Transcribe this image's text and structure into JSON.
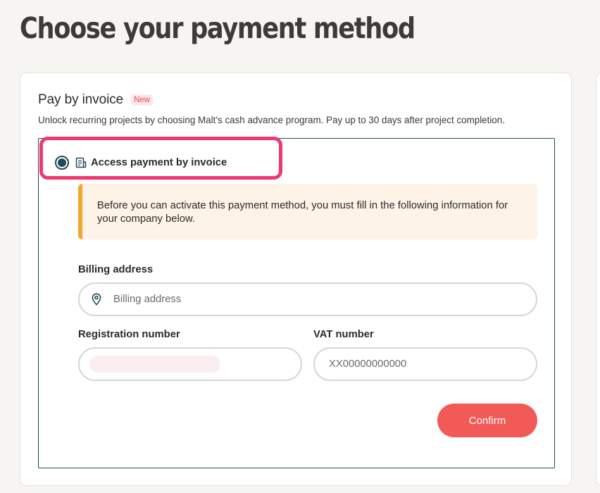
{
  "page": {
    "title": "Choose your payment method"
  },
  "invoice_section": {
    "title": "Pay by invoice",
    "badge": "New",
    "description": "Unlock recurring projects by choosing Malt’s cash advance program. Pay up to 30 days after project completion.",
    "option": {
      "label": "Access payment by invoice",
      "selected": true,
      "icon": "invoice-icon"
    },
    "notice": {
      "text": "Before you can activate this payment method, you must fill in the following information for your company below."
    },
    "billing_address": {
      "label": "Billing address",
      "placeholder": "Billing address",
      "value": "",
      "icon": "location-pin-icon"
    },
    "registration_number": {
      "label": "Registration number",
      "value": ""
    },
    "vat_number": {
      "label": "VAT number",
      "placeholder": "XX00000000000",
      "value": ""
    },
    "confirm_label": "Confirm"
  },
  "colors": {
    "accent": "#f25a57",
    "highlight": "#f0386e",
    "primary_dark": "#1f4b57",
    "notice_bar": "#f4a62a",
    "notice_bg": "#fdf3e6",
    "badge_text": "#e44b4b"
  }
}
